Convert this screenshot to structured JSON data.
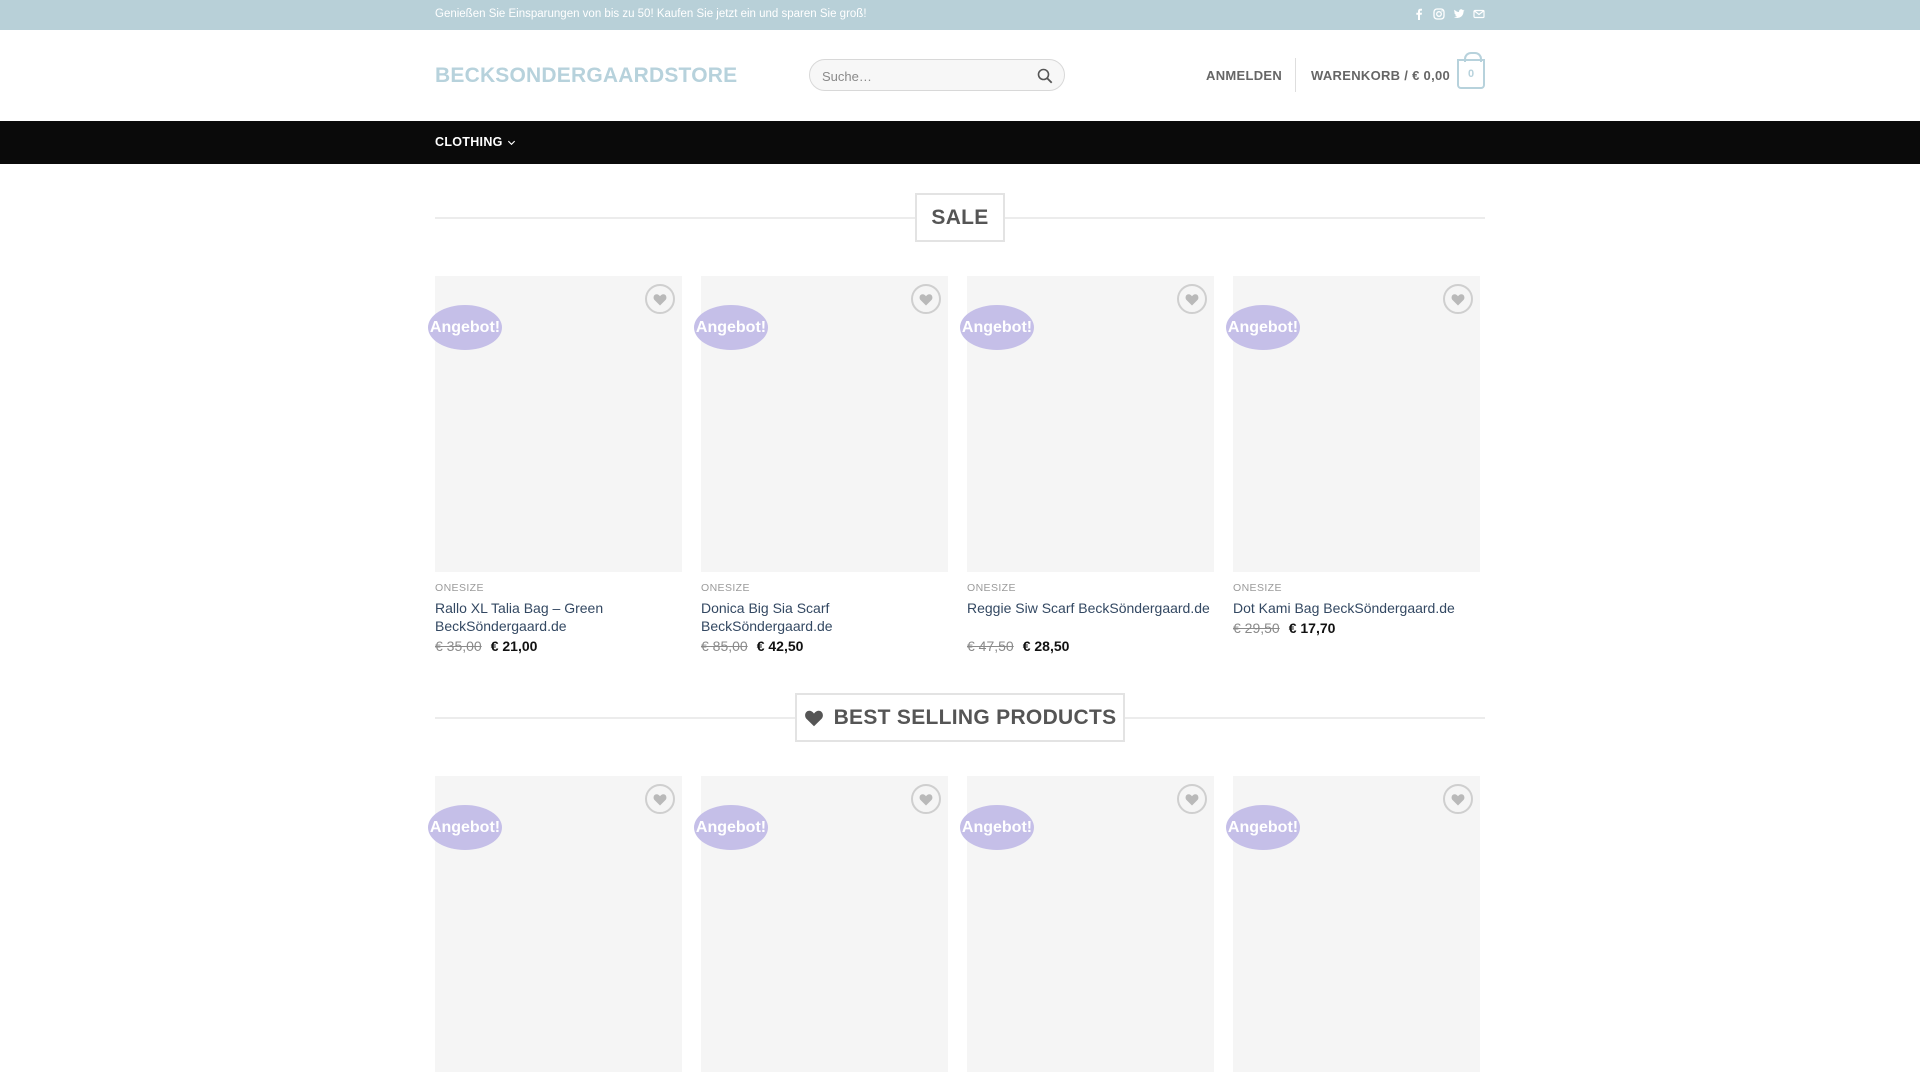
{
  "topbar": {
    "promo_text": "Genießen Sie Einsparungen von bis zu 50! Kaufen Sie jetzt ein und sparen Sie groß!",
    "social_icons": [
      "facebook-icon",
      "instagram-icon",
      "twitter-icon",
      "email-icon"
    ]
  },
  "header": {
    "logo": "BECKSONDERGAARDSTORE",
    "search_placeholder": "Suche…",
    "login_label": "ANMELDEN",
    "cart_label": "WARENKORB / € 0,00",
    "cart_count": "0"
  },
  "nav": {
    "items": [
      {
        "label": "CLOTHING",
        "has_dropdown": true
      }
    ]
  },
  "colors": {
    "topbar_bg": "#b8d0d8",
    "logo": "#b7d2dc",
    "nav_bg": "#0a0a0a",
    "badge_bg": "#c5bfe8",
    "product_title": "#334862"
  },
  "sale_section": {
    "title": "SALE",
    "products": [
      {
        "badge": "Angebot!",
        "category": "ONESIZE",
        "title": "Rallo XL Talia Bag – Green BeckSöndergaard.de",
        "old_price": "€ 35,00",
        "new_price": "€ 21,00"
      },
      {
        "badge": "Angebot!",
        "category": "ONESIZE",
        "title": "Donica Big Sia Scarf BeckSöndergaard.de",
        "old_price": "€ 85,00",
        "new_price": "€ 42,50"
      },
      {
        "badge": "Angebot!",
        "category": "ONESIZE",
        "title": "Reggie Siw Scarf BeckSöndergaard.de",
        "old_price": "€ 47,50",
        "new_price": "€ 28,50"
      },
      {
        "badge": "Angebot!",
        "category": "ONESIZE",
        "title": "Dot Kami Bag BeckSöndergaard.de",
        "old_price": "€ 29,50",
        "new_price": "€ 17,70"
      }
    ]
  },
  "bestselling_section": {
    "title": "BEST SELLING PRODUCTS",
    "icon": "heart-icon",
    "products": [
      {
        "badge": "Angebot!"
      },
      {
        "badge": "Angebot!"
      },
      {
        "badge": "Angebot!"
      },
      {
        "badge": "Angebot!"
      }
    ]
  }
}
